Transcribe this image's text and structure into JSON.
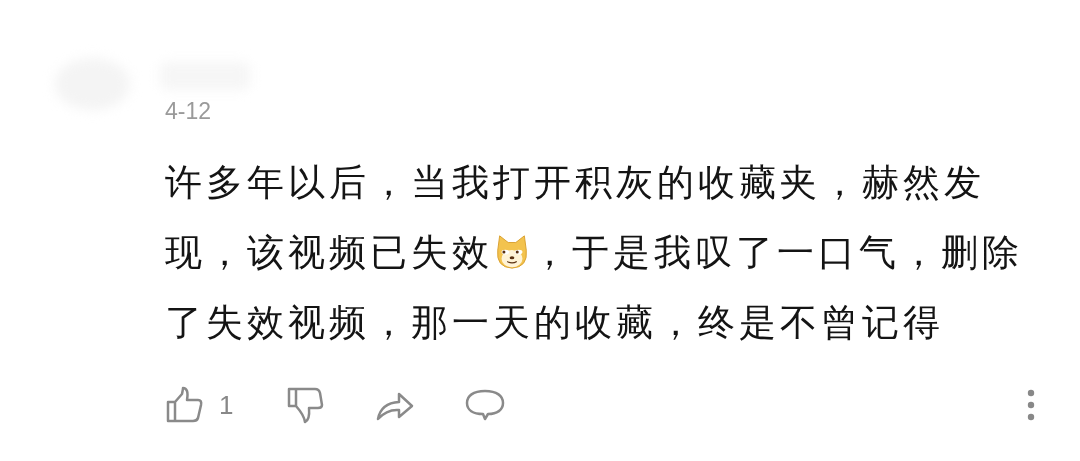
{
  "comment": {
    "date": "4-12",
    "body": [
      {
        "kind": "text",
        "text": "许多年以后，当我打开积灰的收藏夹，赫然发现，该视频已失效"
      },
      {
        "kind": "emoji"
      },
      {
        "kind": "text",
        "text": "，于是我叹了一口气，删除了失效视频，那一天的收藏，终是不曾记得"
      }
    ],
    "like_count": "1"
  }
}
